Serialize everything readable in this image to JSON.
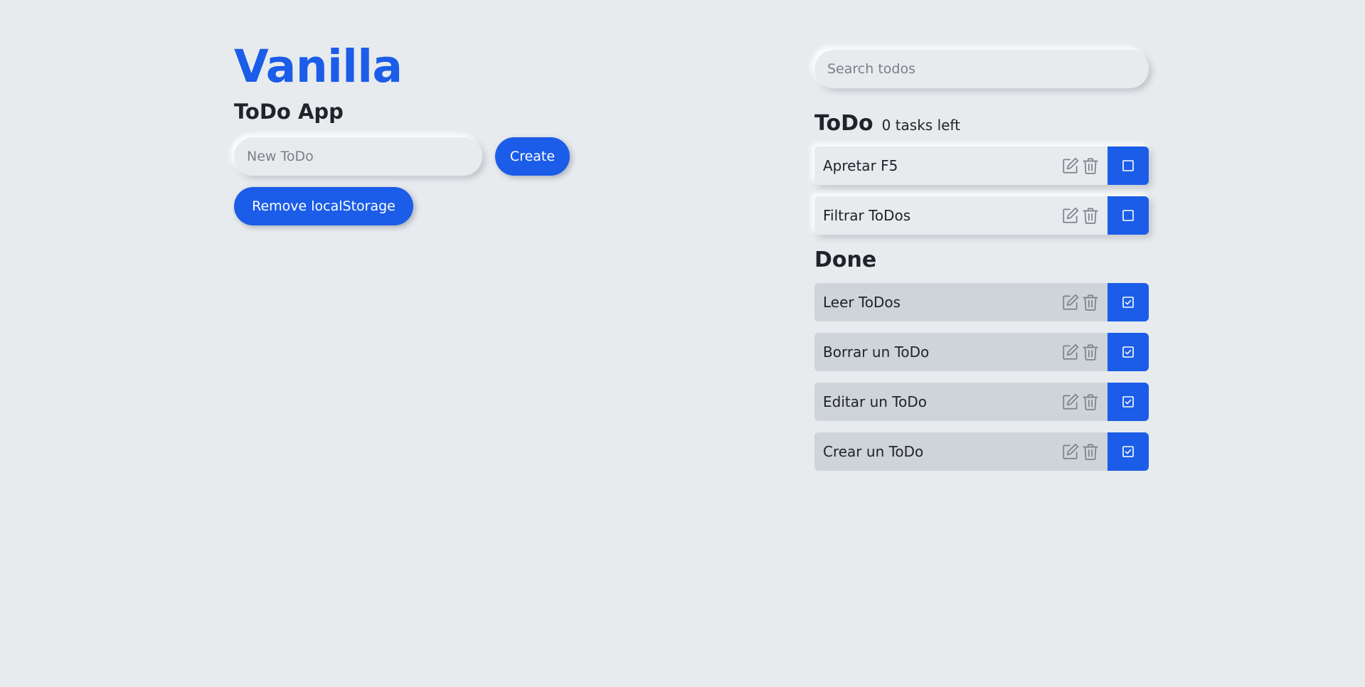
{
  "app": {
    "brand": "Vanilla",
    "subtitle": "ToDo App"
  },
  "create_form": {
    "input_placeholder": "New ToDo",
    "input_value": "",
    "create_label": "Create",
    "remove_label": "Remove localStorage"
  },
  "search": {
    "placeholder": "Search todos",
    "value": ""
  },
  "todo_section": {
    "title": "ToDo",
    "tasks_left": "0 tasks left",
    "items": [
      {
        "text": "Apretar F5",
        "done": false
      },
      {
        "text": "Filtrar ToDos",
        "done": false
      }
    ]
  },
  "done_section": {
    "title": "Done",
    "items": [
      {
        "text": "Leer ToDos",
        "done": true
      },
      {
        "text": "Borrar un ToDo",
        "done": true
      },
      {
        "text": "Editar un ToDo",
        "done": true
      },
      {
        "text": "Crear un ToDo",
        "done": true
      }
    ]
  },
  "icons": {
    "edit": "edit-icon",
    "delete": "trash-icon",
    "unchecked": "checkbox-unchecked-icon",
    "checked": "checkbox-checked-icon"
  },
  "colors": {
    "accent": "#1b5de8",
    "background": "#e8ebee",
    "done_item": "#cfd3da",
    "icon_gray": "#7d838b"
  }
}
